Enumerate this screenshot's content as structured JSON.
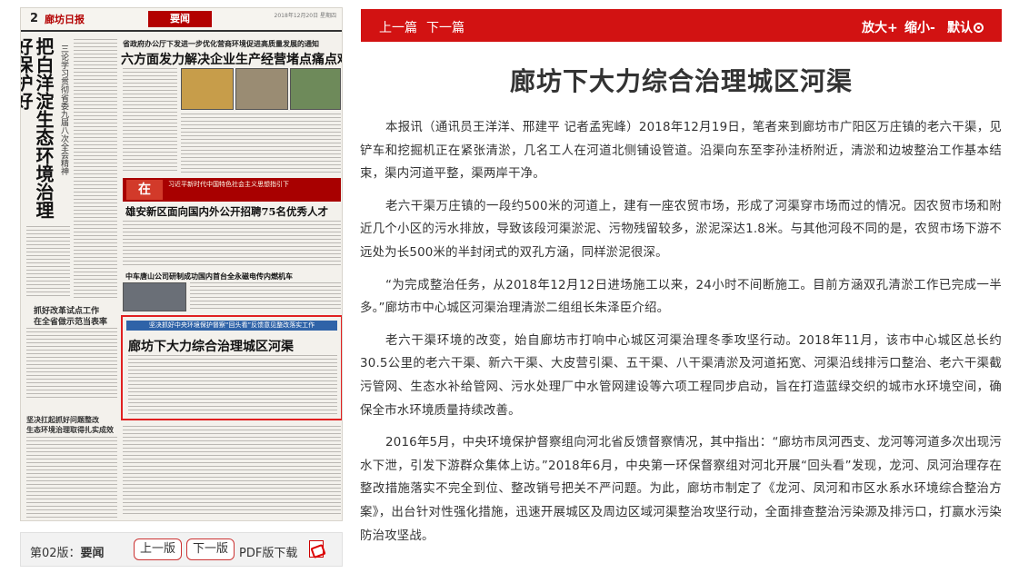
{
  "thumbnail": {
    "page_number": "2",
    "logo": "廊坊日报",
    "section": "要闻",
    "meta": "2018年12月20日 星期四",
    "vertical_title": "把白洋淀生态环境治理好保护好",
    "vertical_subtitle": "三论学习贯彻省委九届八次全会精神",
    "headline_top": "省政府办公厅下发进一步优化营商环境促进高质量发展的通知",
    "headline_main": "六方面发力解决企业生产经营堵点痛点难点",
    "banner_text": "习近平新时代中国特色社会主义思想指引下",
    "banner_icon": "在",
    "headline_xiongan": "雄安新区面向国内外公开招聘75名优秀人才",
    "headline_zhongche": "中车唐山公司研制成功国内首台全永磁电传内燃机车",
    "headline_left_small_1": "抓好改革试点工作",
    "headline_left_small_2": "在全省做示范当表率",
    "headline_left_small_3": "坚决扛起抓好问题整改",
    "headline_left_small_4": "生态环境治理取得扎实成效",
    "highlight_bar": "坚决抓好中央环境保护督察“回头看”反馈意见整改落实工作",
    "highlight_title": "廊坊下大力综合治理城区河渠"
  },
  "page_nav": {
    "label": "第02版：",
    "section": "要闻",
    "prev": "上一版",
    "next": "下一版",
    "pdf": "PDF版下载"
  },
  "toolbar": {
    "prev": "上一篇",
    "next": "下一篇",
    "zoom_in": "放大+",
    "zoom_out": "缩小-",
    "default": "默认"
  },
  "article": {
    "title": "廊坊下大力综合治理城区河渠",
    "paragraphs": [
      "本报讯（通讯员王洋洋、邢建平 记者孟宪峰）2018年12月19日，笔者来到廊坊市广阳区万庄镇的老六干渠，见铲车和挖掘机正在紧张清淤，几名工人在河道北侧铺设管道。沿渠向东至李孙洼桥附近，清淤和边坡整治工作基本结束，渠内河道平整，渠两岸干净。",
      "老六干渠万庄镇的一段约500米的河道上，建有一座农贸市场，形成了河渠穿市场而过的情况。因农贸市场和附近几个小区的污水排放，导致该段河渠淤泥、污物残留较多，淤泥深达1.8米。与其他河段不同的是，农贸市场下游不远处为长500米的半封闭式的双孔方涵，同样淤泥很深。",
      "“为完成整治任务，从2018年12月12日进场施工以来，24小时不间断施工。目前方涵双孔清淤工作已完成一半多。”廊坊市中心城区河渠治理清淤二组组长朱泽臣介绍。",
      "老六干渠环境的改变，始自廊坊市打响中心城区河渠治理冬季攻坚行动。2018年11月，该市中心城区总长约30.5公里的老六干渠、新六干渠、大皮营引渠、五干渠、八干渠清淤及河道拓宽、河渠沿线排污口整治、老六干渠截污管网、生态水补给管网、污水处理厂中水管网建设等六项工程同步启动，旨在打造蓝绿交织的城市水环境空间，确保全市水环境质量持续改善。",
      "2016年5月，中央环境保护督察组向河北省反馈督察情况，其中指出：“廊坊市凤河西支、龙河等河道多次出现污水下泄，引发下游群众集体上访。”2018年6月，中央第一环保督察组对河北开展“回头看”发现，龙河、凤河治理存在整改措施落实不完全到位、整改销号把关不严问题。为此，廊坊市制定了《龙河、凤河和市区水系水环境综合整治方案》，出台针对性强化措施，迅速开展城区及周边区域河渠整治攻坚行动，全面排查整治污染源及排污口，打赢水污染防治攻坚战。"
    ]
  },
  "colors": {
    "toolbar_bg": "#d21212",
    "highlight_border": "#e02020",
    "nav_button_border": "#cc3333"
  }
}
